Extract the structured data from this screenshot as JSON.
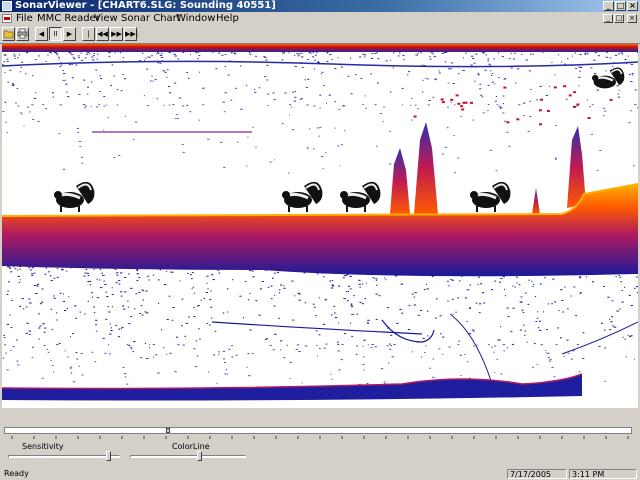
{
  "window": {
    "title": "SonarViewer - [CHART6.SLG: Sounding 40551]",
    "controls": {
      "minimize": "_",
      "maximize": "□",
      "close": "×"
    }
  },
  "menu": {
    "items": [
      "File",
      "MMC Reader",
      "View",
      "Sonar Chart",
      "Window",
      "Help"
    ],
    "mdi_controls": {
      "minimize": "_",
      "restore": "□",
      "close": "×"
    }
  },
  "toolbar": {
    "buttons": [
      {
        "icon": "open-folder-icon"
      },
      {
        "icon": "print-icon"
      },
      {
        "icon": "play-reverse-icon",
        "glyph": "◀"
      },
      {
        "icon": "pause-icon",
        "glyph": "II",
        "pressed": true
      },
      {
        "icon": "play-icon",
        "glyph": "▶"
      },
      {
        "icon": "skip-to-start-icon",
        "glyph": "|◀◀"
      },
      {
        "icon": "rewind-icon",
        "glyph": "◀◀"
      },
      {
        "icon": "fast-forward-icon",
        "glyph": "▶▶"
      },
      {
        "icon": "skip-to-end-icon",
        "glyph": "▶▶|"
      }
    ]
  },
  "chart": {
    "colors": {
      "surface": "#c01010",
      "bottom_return": "#ff5a00",
      "clutter": "#1a1a9a",
      "noise": "#6a5ab8"
    }
  },
  "scroll": {
    "position": 0.26
  },
  "sliders": {
    "sensitivity": {
      "label": "Sensitivity",
      "level": 0.9
    },
    "colorline": {
      "label": "ColorLine",
      "level": 0.6
    }
  },
  "status": {
    "text": "Ready",
    "date": "7/17/2005",
    "time": "3:11 PM"
  }
}
